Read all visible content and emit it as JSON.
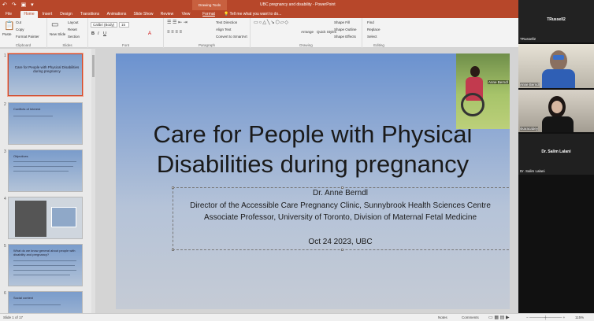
{
  "window": {
    "title": "UBC pregnancy and disability - PowerPoint",
    "quick_access": "↶ ↷ ▣ ▾"
  },
  "drawing_tools": "Drawing Tools",
  "tabs": [
    "File",
    "Home",
    "Insert",
    "Design",
    "Transitions",
    "Animations",
    "Slide Show",
    "Review",
    "View",
    "Format"
  ],
  "tell_me": "Tell me what you want to do...",
  "ribbon": {
    "clipboard": {
      "label": "Clipboard",
      "paste": "Paste",
      "cut": "Cut",
      "copy": "Copy",
      "format_painter": "Format Painter"
    },
    "slides": {
      "label": "Slides",
      "new_slide": "New Slide",
      "layout": "Layout",
      "reset": "Reset",
      "section": "Section"
    },
    "font": {
      "label": "Font",
      "name": "Calibri (Body)",
      "size": "15"
    },
    "paragraph": {
      "label": "Paragraph",
      "text_direction": "Text Direction",
      "align_text": "Align Text",
      "smartart": "Convert to SmartArt"
    },
    "drawing": {
      "label": "Drawing",
      "arrange": "Arrange",
      "quick_styles": "Quick Styles",
      "shape_fill": "Shape Fill",
      "shape_outline": "Shape Outline",
      "shape_effects": "Shape Effects"
    },
    "editing": {
      "label": "Editing",
      "find": "Find",
      "replace": "Replace",
      "select": "Select"
    }
  },
  "thumbnails": [
    {
      "num": "1",
      "title": "Care for People with Physical Disabilities during pregnancy"
    },
    {
      "num": "2",
      "title": "Conflicts of Interest"
    },
    {
      "num": "3",
      "title": "Objectives"
    },
    {
      "num": "4",
      "title": ""
    },
    {
      "num": "5",
      "title": "What do we know general about people with disability and pregnancy?"
    },
    {
      "num": "6",
      "title": "Social context"
    }
  ],
  "slide": {
    "title_line1": "Care for People with Physical",
    "title_line2": "Disabilities during pregnancy",
    "presenter": "Dr. Anne Berndl",
    "role1": "Director of the Accessible Care Pregnancy Clinic, Sunnybrook Health Sciences Centre",
    "role2": "Associate Professor, University of Toronto, Division of Maternal Fetal Medicine",
    "date": "Oct 24 2023, UBC",
    "overlay_name": "Anne Berndl"
  },
  "participants": [
    {
      "name": "TRussell2",
      "big": "TRussell2"
    },
    {
      "name": "Anne Berndl"
    },
    {
      "name": "skaracabey"
    },
    {
      "name": "Dr. Salim Lalani",
      "big": "Dr. Salim Lalani"
    }
  ],
  "status": {
    "slide": "Slide 1 of 17",
    "notes": "Notes",
    "comments": "Comments",
    "zoom": "115%"
  },
  "colors": {
    "brand": "#b7472a",
    "slide_top": "#6b92cf",
    "slide_bottom": "#c5cbd5"
  }
}
